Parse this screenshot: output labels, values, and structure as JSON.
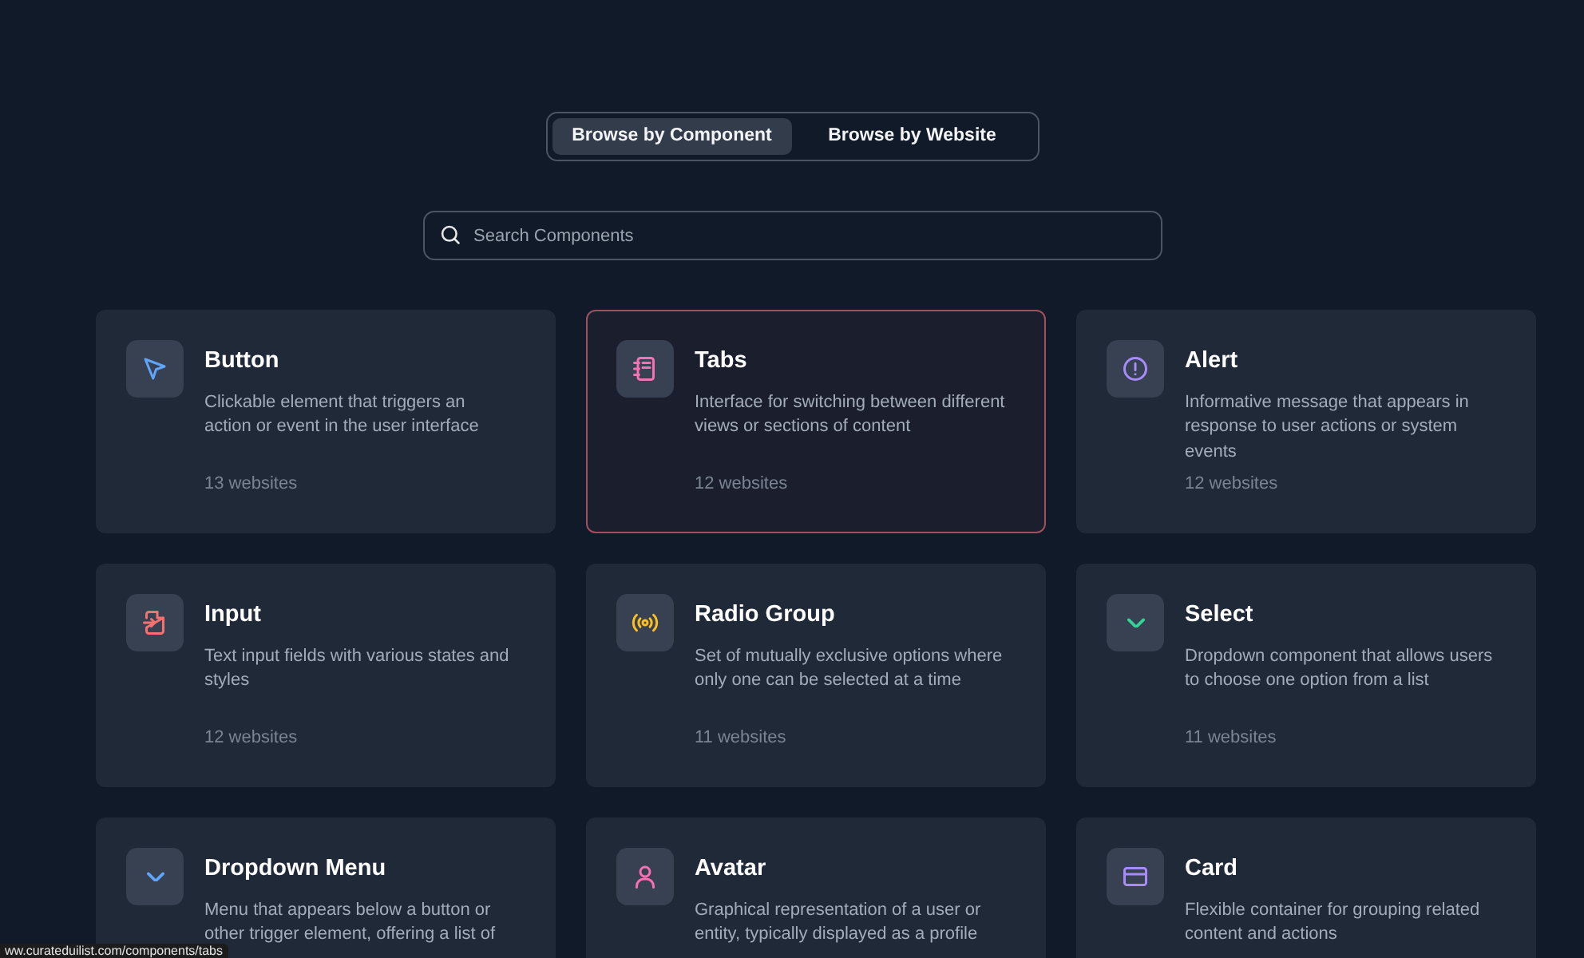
{
  "view_toggle": [
    {
      "label": "Browse by Component",
      "selected": true
    },
    {
      "label": "Browse by Website",
      "selected": false
    }
  ],
  "search": {
    "placeholder": "Search Components"
  },
  "components": [
    {
      "title": "Button",
      "description": "Clickable element that triggers an action or event in the user interface",
      "count": "13 websites",
      "hovered": false
    },
    {
      "title": "Tabs",
      "description": "Interface for switching between different views or sections of content",
      "count": "12 websites",
      "hovered": true
    },
    {
      "title": "Alert",
      "description": "Informative message that appears in response to user actions or system events",
      "count": "12 websites",
      "hovered": false
    },
    {
      "title": "Input",
      "description": "Text input fields with various states and styles",
      "count": "12 websites",
      "hovered": false
    },
    {
      "title": "Radio Group",
      "description": "Set of mutually exclusive options where only one can be selected at a time",
      "count": "11 websites",
      "hovered": false
    },
    {
      "title": "Select",
      "description": "Dropdown component that allows users to choose one option from a list",
      "count": "11 websites",
      "hovered": false
    },
    {
      "title": "Dropdown Menu",
      "description": "Menu that appears below a button or other trigger element, offering a list of",
      "hovered": false
    },
    {
      "title": "Avatar",
      "description": "Graphical representation of a user or entity, typically displayed as a profile",
      "hovered": false
    },
    {
      "title": "Card",
      "description": "Flexible container for grouping related content and actions",
      "hovered": false
    }
  ],
  "status_bar": {
    "url": "ww.curateduilist.com/components/tabs"
  }
}
